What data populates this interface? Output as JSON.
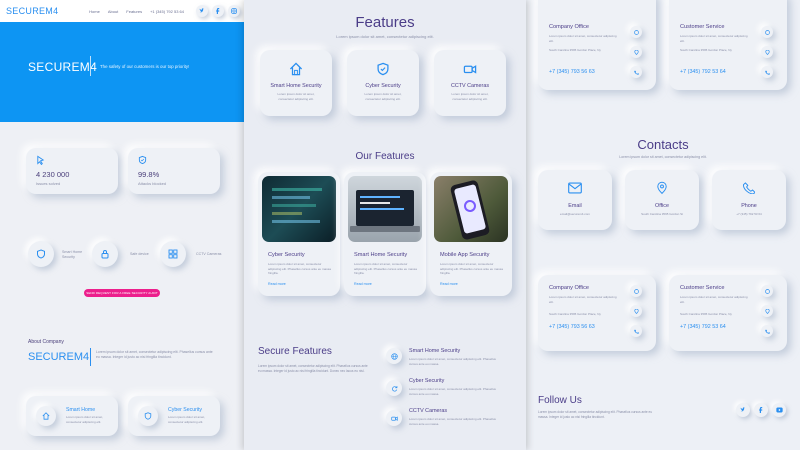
{
  "panel1": {
    "logo": "SECUREM4",
    "nav": [
      "Home",
      "About",
      "Features",
      "+1 (345) 792 53 64"
    ],
    "hero_logo": "SECUREM4",
    "hero_tagline": "The safety of our customers is our top priority!",
    "stats": [
      {
        "value": "4 230 000",
        "caption": "Issues solved"
      },
      {
        "value": "99.8%",
        "caption": "Attacks blocked"
      }
    ],
    "features_row": [
      "Smart Home Security",
      "Safe device",
      "CCTV Cameras"
    ],
    "cta_label": "SEND REQUEST FOR A FREE SECURITY AUDIT",
    "about_label": "About Company",
    "about_logo": "SECUREM4",
    "about_text": "Lorem ipsum dolor sit amet, consectetur adipiscing elit. Phasellus cursus ante eu massa. Integer id justo ac nisi fringilla tincidunt.",
    "bottom_cards": [
      {
        "title": "Smart Home",
        "text": "Lorem ipsum dolor sit amet, consectetur adipiscing elit."
      },
      {
        "title": "Cyber Security",
        "text": "Lorem ipsum dolor sit amet, consectetur adipiscing elit."
      }
    ]
  },
  "panel2": {
    "features_title": "Features",
    "features_sub": "Lorem ipsum dolor sit amet, consectetur adipiscing elit.",
    "feature_cards": [
      {
        "label": "Smart Home Security",
        "icon": "home-icon"
      },
      {
        "label": "Cyber Security",
        "icon": "shield-icon"
      },
      {
        "label": "CCTV Cameras",
        "icon": "camera-icon"
      }
    ],
    "our_features_title": "Our Features",
    "our_cards": [
      {
        "title": "Cyber Security",
        "text": "Lorem ipsum dolor sit amet, consectetur adipiscing elit. Phasellus cursus ante eu massa fringilla.",
        "link": "Read more"
      },
      {
        "title": "Smart Home Security",
        "text": "Lorem ipsum dolor sit amet, consectetur adipiscing elit. Phasellus cursus ante eu massa fringilla.",
        "link": "Read more"
      },
      {
        "title": "Mobile App Security",
        "text": "Lorem ipsum dolor sit amet, consectetur adipiscing elit. Phasellus cursus ante eu massa fringilla.",
        "link": "Read more"
      }
    ],
    "secure_title": "Secure Features",
    "secure_text": "Lorem ipsum dolor sit amet, consectetur adipiscing elit. Phasellus cursus ante eu massa. Integer id justo ac nisi fringilla tincidunt. Donec nec lacus eu nisl.",
    "secure_items": [
      {
        "title": "Smart Home Security",
        "text": "Lorem ipsum dolor sit amet, consectetur adipiscing elit. Phasellus cursus ante eu massa."
      },
      {
        "title": "Cyber Security",
        "text": "Lorem ipsum dolor sit amet, consectetur adipiscing elit. Phasellus cursus ante eu massa."
      },
      {
        "title": "CCTV Cameras",
        "text": "Lorem ipsum dolor sit amet, consectetur adipiscing elit. Phasellus cursus ante eu massa."
      }
    ]
  },
  "panel3": {
    "top_cards": [
      {
        "title": "Company Office",
        "text": "Lorem ipsum dolor sit amet, consectetur adipiscing elit.",
        "addr": "South Carolina 3595 Gordon Place, Ny",
        "phone": "+7 (345) 793 56 63"
      },
      {
        "title": "Customer Service",
        "text": "Lorem ipsum dolor sit amet, consectetur adipiscing elit.",
        "addr": "South Carolina 3595 Gordon Place, Ny",
        "phone": "+7 (345) 792 53 64"
      }
    ],
    "contacts_title": "Contacts",
    "contacts_sub": "Lorem ipsum dolor sit amet, consectetur adipiscing elit.",
    "contact_cards": [
      {
        "label": "Email",
        "value": "email@securem4.com"
      },
      {
        "label": "Office",
        "value": "South Carolina 3595 Gordon St"
      },
      {
        "label": "Phone",
        "value": "+7 (345) 792 53 64"
      }
    ],
    "mid_cards": [
      {
        "title": "Company Office",
        "text": "Lorem ipsum dolor sit amet, consectetur adipiscing elit.",
        "addr": "South Carolina 3595 Gordon Place, Ny",
        "phone": "+7 (345) 793 56 63"
      },
      {
        "title": "Customer Service",
        "text": "Lorem ipsum dolor sit amet, consectetur adipiscing elit.",
        "addr": "South Carolina 3595 Gordon Place, Ny",
        "phone": "+7 (345) 792 53 64"
      }
    ],
    "follow_title": "Follow Us",
    "follow_text": "Lorem ipsum dolor sit amet, consectetur adipiscing elit. Phasellus cursus ante eu massa. Integer id justo ac nisi fringilla tincidunt."
  },
  "colors": {
    "accent": "#0d95f3",
    "purple": "#4b3d88",
    "cta": "#ec1f8c",
    "bg": "#eceff5"
  }
}
